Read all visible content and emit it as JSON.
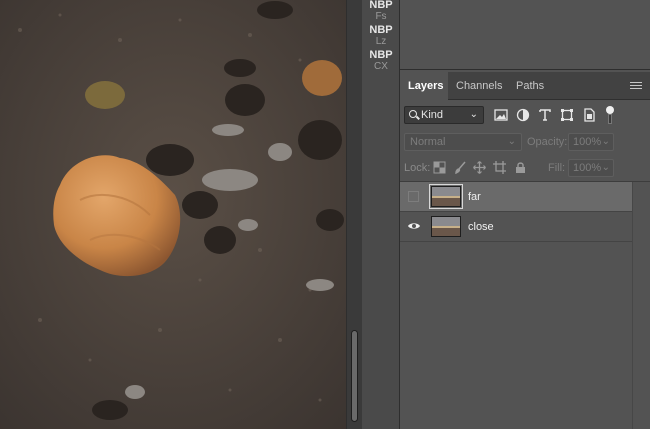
{
  "plugin_strip": {
    "buttons": [
      {
        "line1": "NBP",
        "line2": "Fs"
      },
      {
        "line1": "NBP",
        "line2": "Lz"
      },
      {
        "line1": "NBP",
        "line2": "CX"
      }
    ]
  },
  "layers_panel": {
    "tabs": [
      {
        "label": "Layers",
        "active": true
      },
      {
        "label": "Channels",
        "active": false
      },
      {
        "label": "Paths",
        "active": false
      }
    ],
    "filter": {
      "kind_label": "Kind",
      "icons": [
        "pixel-filter-icon",
        "adjustment-filter-icon",
        "type-filter-icon",
        "shape-filter-icon",
        "smart-object-filter-icon"
      ]
    },
    "blend_mode": "Normal",
    "opacity_label": "Opacity:",
    "opacity_value": "100%",
    "lock_label": "Lock:",
    "fill_label": "Fill:",
    "fill_value": "100%",
    "layers": [
      {
        "name": "far",
        "visible": false,
        "selected": true
      },
      {
        "name": "close",
        "visible": true,
        "selected": false
      }
    ]
  },
  "colors": {
    "panel_bg": "#535353",
    "selected_row": "#6a6a6a",
    "tab_bar": "#424242"
  }
}
